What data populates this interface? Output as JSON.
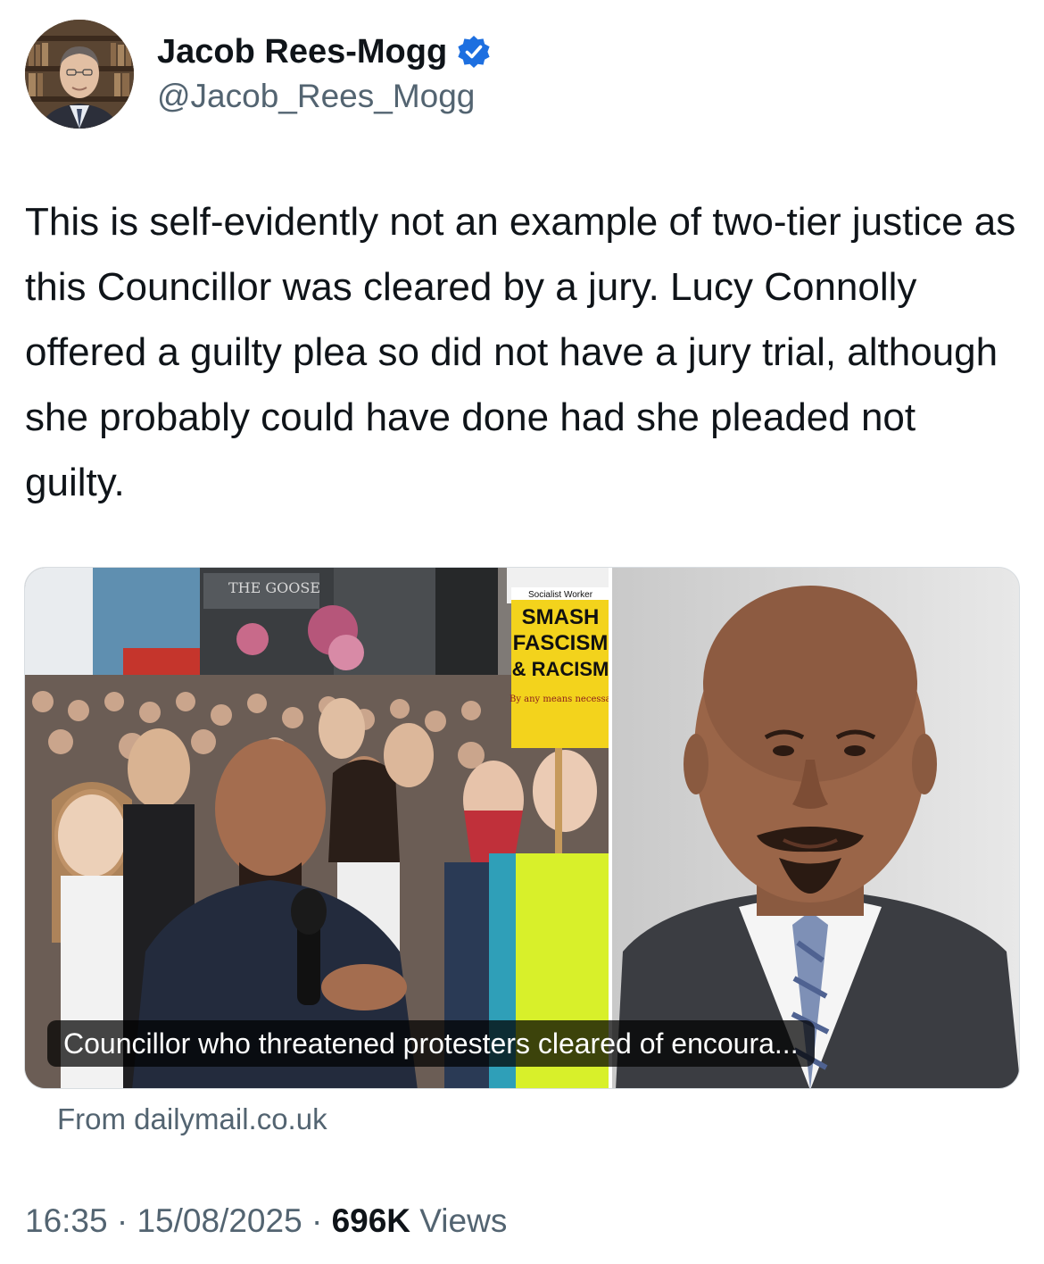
{
  "author": {
    "name": "Jacob Rees-Mogg",
    "handle": "@Jacob_Rees_Mogg",
    "verified": true,
    "verified_icon": "verified-badge-icon",
    "verified_color": "#1d6fe0"
  },
  "tweet": {
    "text": "This is self-evidently not an example of two-tier justice as this Councillor was cleared by a jury. Lucy Connolly offered a guilty plea so did not have a jury trial, although she probably could have done had she pleaded not guilty."
  },
  "link_card": {
    "caption": "Councillor who threatened protesters cleared of encoura...",
    "source": "From dailymail.co.uk",
    "image_text": {
      "building_sign": "THE GOOSE",
      "placard_header": "Socialist Worker",
      "placard_lines": [
        "SMASH",
        "FASCISM",
        "& RACISM"
      ],
      "placard_footer": "By any means necessary"
    }
  },
  "meta": {
    "time": "16:35",
    "separator": "·",
    "date": "15/08/2025",
    "views_count": "696K",
    "views_label": "Views"
  },
  "colors": {
    "text_primary": "#0f1419",
    "text_secondary": "#536471",
    "placard_yellow": "#f3d31c",
    "hi_vis": "#d8f02a"
  }
}
